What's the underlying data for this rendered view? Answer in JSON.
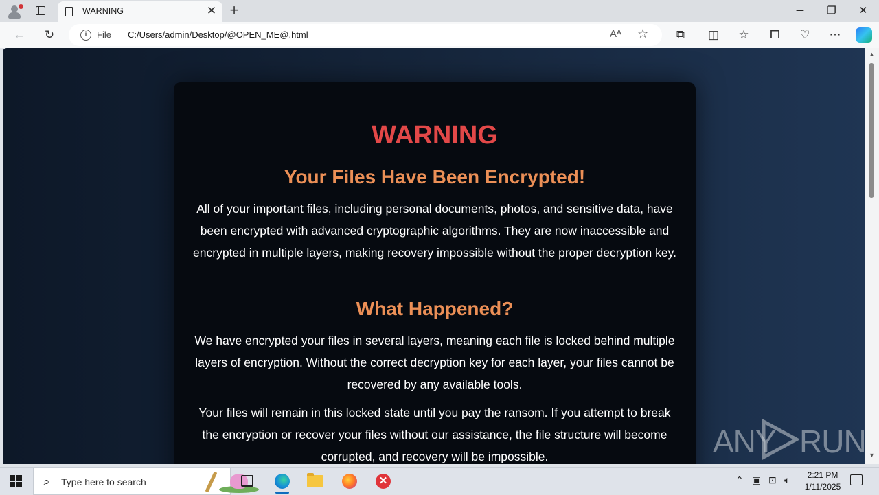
{
  "browser": {
    "tab_title": "WARNING",
    "tab_close": "✕",
    "new_tab": "+",
    "window_controls": {
      "minimize": "─",
      "restore": "❐",
      "close": "✕"
    },
    "address": {
      "scheme_label": "File",
      "url": "C:/Users/admin/Desktop/@OPEN_ME@.html"
    }
  },
  "page": {
    "title": "WARNING",
    "heading1": "Your Files Have Been Encrypted!",
    "para1": "All of your important files, including personal documents, photos, and sensitive data, have been encrypted with advanced cryptographic algorithms. They are now inaccessible and encrypted in multiple layers, making recovery impossible without the proper decryption key.",
    "heading2": "What Happened?",
    "para2": "We have encrypted your files in several layers, meaning each file is locked behind multiple layers of encryption. Without the correct decryption key for each layer, your files cannot be recovered by any available tools.",
    "para3": "Your files will remain in this locked state until you pay the ransom. If you attempt to break the encryption or recover your files without our assistance, the file structure will become corrupted, and recovery will be impossible."
  },
  "watermark": {
    "left": "ANY",
    "right": "RUN"
  },
  "taskbar": {
    "search_placeholder": "Type here to search",
    "time": "2:21 PM",
    "date": "1/11/2025"
  },
  "colors": {
    "warning_red": "#e24848",
    "heading_orange": "#eb8f56",
    "card_bg": "#060a10",
    "page_bg": "#16263c"
  }
}
